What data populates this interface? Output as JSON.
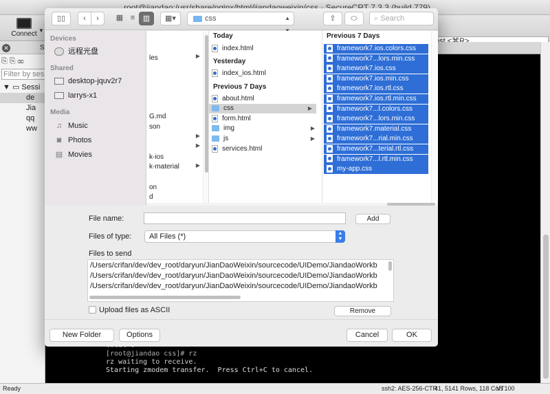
{
  "app": {
    "title": "root@jiandao:/usr/share/nginx/html/jiandaoweixin/css - SecureCRT 7.3.3 (build 779)",
    "connect_label": "Connect",
    "quick_connect_hint": "ost <⌘R>"
  },
  "session_panel": {
    "tab_label": "Se",
    "filter_placeholder": "Filter by sess",
    "tree": [
      "Sessi",
      "de",
      "Jia",
      "qq",
      "ww"
    ]
  },
  "terminal": {
    "lines": [
      "total 0",
      "[root@jiandao css]# rz",
      "rz waiting to receive.",
      "Starting zmodem transfer.  Press Ctrl+C to cancel."
    ]
  },
  "status": {
    "ready": "Ready",
    "ssh": "ssh2: AES-256-CTR",
    "position": "41, 51",
    "rows_cols": "41 Rows, 118 Cols",
    "terminal_type": "VT100"
  },
  "dialog": {
    "toolbar": {
      "path": "css",
      "search_placeholder": "Search"
    },
    "sidebar": {
      "devices_header": "Devices",
      "devices": [
        "远程光盘"
      ],
      "shared_header": "Shared",
      "shared": [
        "desktop-jquv2r7",
        "larrys-x1"
      ],
      "media_header": "Media",
      "media": [
        "Music",
        "Photos",
        "Movies"
      ]
    },
    "partial_column": [
      "les",
      "G.md",
      "son",
      "k-ios",
      "k-material",
      "on",
      "d"
    ],
    "main_column": {
      "groups": [
        {
          "header": "Today",
          "items": [
            {
              "name": "index.html",
              "kind": "file"
            }
          ]
        },
        {
          "header": "Yesterday",
          "items": [
            {
              "name": "index_ios.html",
              "kind": "file"
            }
          ]
        },
        {
          "header": "Previous 7 Days",
          "items": [
            {
              "name": "about.html",
              "kind": "file"
            },
            {
              "name": "css",
              "kind": "folder"
            },
            {
              "name": "form.html",
              "kind": "file"
            },
            {
              "name": "img",
              "kind": "folder"
            },
            {
              "name": "js",
              "kind": "folder"
            },
            {
              "name": "services.html",
              "kind": "file"
            }
          ]
        }
      ]
    },
    "css_column": {
      "header": "Previous 7 Days",
      "files": [
        "framework7.ios.colors.css",
        "framework7...lors.min.css",
        "framework7.ios.css",
        "framework7.ios.min.css",
        "framework7.ios.rtl.css",
        "framework7.ios.rtl.min.css",
        "framework7...l.colors.css",
        "framework7...lors.min.css",
        "framework7.material.css",
        "framework7...rial.min.css",
        "framework7...terial.rtl.css",
        "framework7...l.rtl.min.css",
        "my-app.css"
      ]
    },
    "form": {
      "file_name_label": "File name:",
      "file_name_value": "",
      "add_label": "Add",
      "type_label": "Files of type:",
      "type_value": "All Files (*)",
      "files_to_send_label": "Files to send",
      "files_to_send": [
        "/Users/crifan/dev/dev_root/daryun/JianDaoWeixin/sourcecode/UIDemo/JiandaoWorkb",
        "/Users/crifan/dev/dev_root/daryun/JianDaoWeixin/sourcecode/UIDemo/JiandaoWorkb",
        "/Users/crifan/dev/dev_root/daryun/JianDaoWeixin/sourcecode/UIDemo/JiandaoWorkb"
      ],
      "ascii_label": "Upload files as ASCII",
      "ascii_checked": false,
      "remove_label": "Remove"
    },
    "footer": {
      "new_folder": "New Folder",
      "options": "Options",
      "cancel": "Cancel",
      "ok": "OK"
    }
  },
  "colors": {
    "selection": "#2e6ed6",
    "select_accent": "#3a7ce8",
    "folder": "#7fb9ee"
  }
}
